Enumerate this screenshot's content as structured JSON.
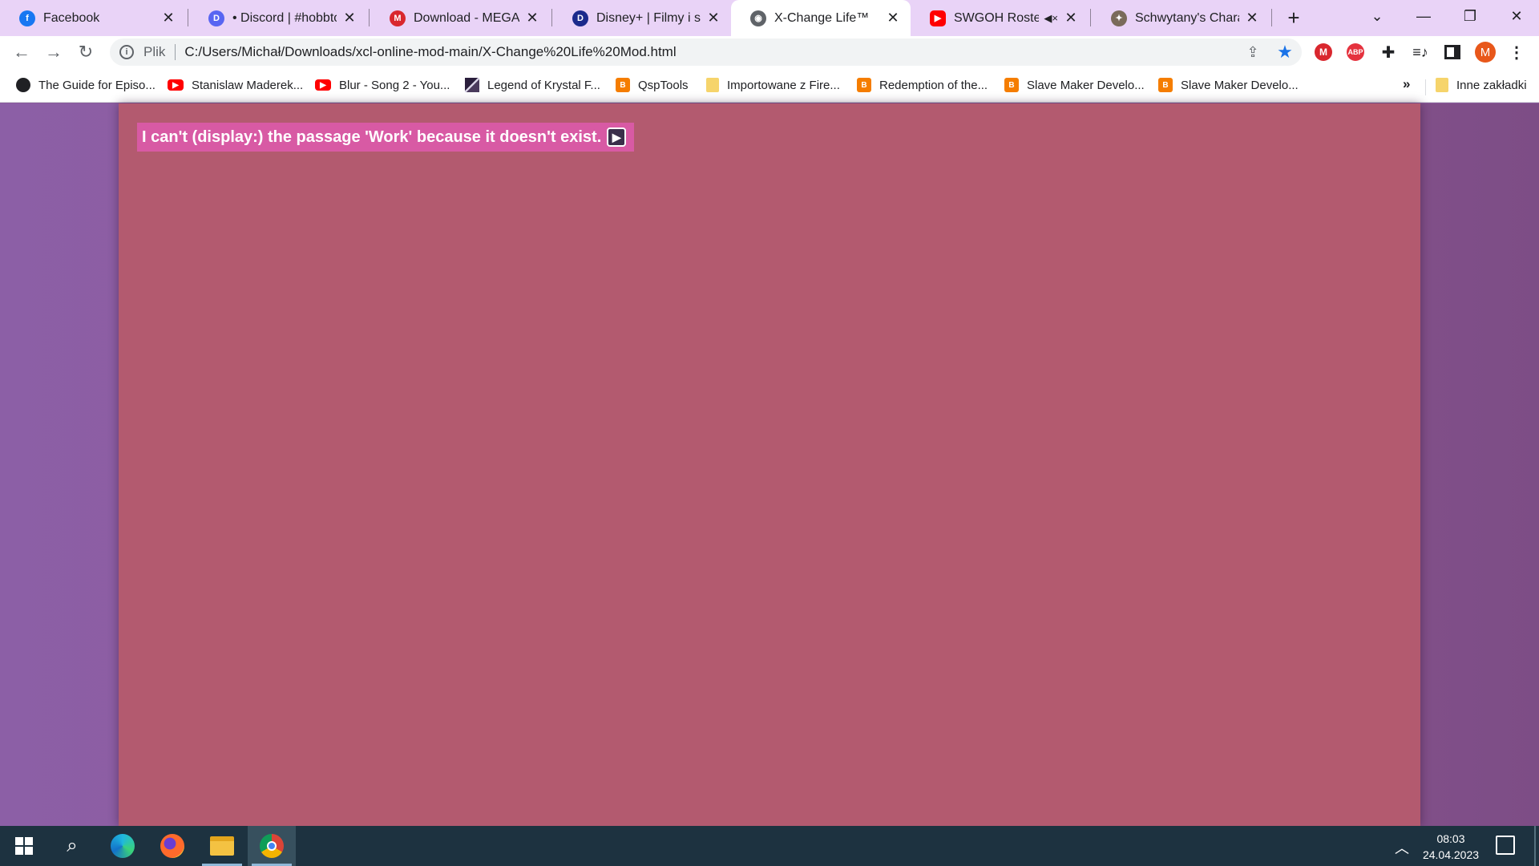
{
  "tabs": [
    {
      "title": "Facebook",
      "icon": "facebook-icon",
      "color": "#1877f2",
      "glyph": "f"
    },
    {
      "title": "• Discord | #hobbton-",
      "icon": "discord-chrome-icon",
      "color": "#5865f2",
      "glyph": "D"
    },
    {
      "title": "Download - MEGA",
      "icon": "mega-icon",
      "color": "#d9272e",
      "glyph": "M"
    },
    {
      "title": "Disney+ | Filmy i seria",
      "icon": "disney-plus-icon",
      "color": "#1b2a8c",
      "glyph": "D"
    },
    {
      "title": "X-Change Life™",
      "icon": "globe-icon",
      "color": "#5f6368",
      "glyph": "◉"
    },
    {
      "title": "SWGOH Roster R",
      "icon": "youtube-icon",
      "color": "#ff0000",
      "glyph": "▶"
    },
    {
      "title": "Schwytany's Characte",
      "icon": "character-icon",
      "color": "#7a6a5a",
      "glyph": "✦"
    }
  ],
  "active_tab_index": 4,
  "omnibox": {
    "scheme_label": "Plik",
    "url": "C:/Users/Michał/Downloads/xcl-online-mod-main/X-Change%20Life%20Mod.html"
  },
  "profile_initial": "M",
  "extensions": {
    "mega": "M",
    "abp": "ABP"
  },
  "bookmarks": [
    {
      "label": "The Guide for Episo...",
      "type": "globe"
    },
    {
      "label": "Stanislaw Maderek...",
      "type": "yt"
    },
    {
      "label": "Blur - Song 2 - You...",
      "type": "yt"
    },
    {
      "label": "Legend of Krystal F...",
      "type": "img"
    },
    {
      "label": "QspTools",
      "type": "blog"
    },
    {
      "label": "Importowane z Fire...",
      "type": "folder"
    },
    {
      "label": "Redemption of the...",
      "type": "blog"
    },
    {
      "label": "Slave Maker Develo...",
      "type": "blog"
    },
    {
      "label": "Slave Maker Develo...",
      "type": "blog"
    }
  ],
  "bookmarks_more": "»",
  "other_bookmarks": "Inne zakładki",
  "content": {
    "error_message": "I can't (display:) the passage 'Work' because it doesn't exist."
  },
  "colors": {
    "story_bg": "#b35a6f",
    "error_bg": "#d85aa4",
    "page_bg": "#8a5a9c",
    "tabstrip_bg": "#e9d3f7"
  },
  "taskbar": {
    "time": "08:03",
    "date": "24.04.2023"
  }
}
